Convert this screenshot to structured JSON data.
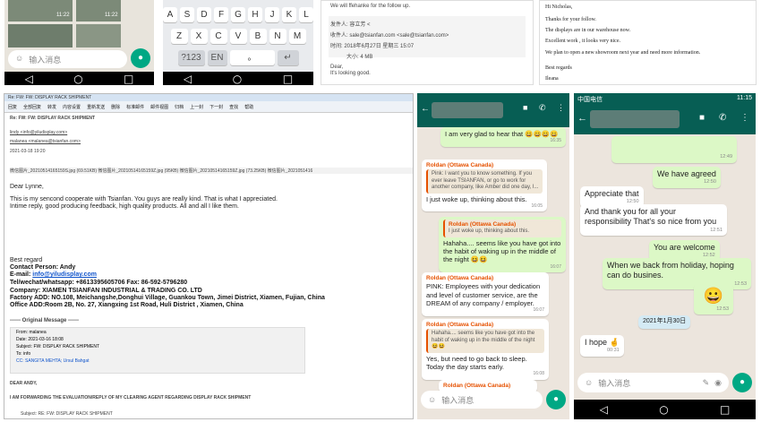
{
  "panel1": {
    "times": [
      "11:22",
      "11:22"
    ],
    "input_placeholder": "输入消息",
    "nav": [
      "◁",
      "○",
      "□"
    ]
  },
  "keyboard": {
    "row1": [
      "A",
      "S",
      "D",
      "F",
      "G",
      "H",
      "J",
      "K",
      "L"
    ],
    "row2": [
      "Z",
      "X",
      "C",
      "V",
      "B",
      "N",
      "M"
    ],
    "row3": [
      "?123",
      "EN",
      "。",
      "↵"
    ],
    "nav": [
      "◁",
      "○",
      "□"
    ]
  },
  "mail_top": {
    "line1": "We will ffehanke for the follow up.",
    "from": "发件人: 容立芳 <",
    "to": "收件人: sale@tsianfan.com <sale@tsianfan.com>",
    "time": "时间: 2018年6月27日 星期三 15:07",
    "size": "大小: 4 MB",
    "dear": "Dear,",
    "good": "It's looking good."
  },
  "letter": {
    "greeting": "Hi Nicholas,",
    "l1": "Thanks for your follow.",
    "l2": "The displays are in our warehouse now.",
    "l3": "Excellent work , it looks very nice.",
    "l4": "We plan to open a new showroom next year and need more information.",
    "l5": "Best regards",
    "l6": "Ileana"
  },
  "outlook": {
    "title": "Re: FW: FW: DISPLAY RACK SHIPMENT",
    "toolbar": [
      "回复",
      "全部回复",
      "转发",
      "内容设置",
      "重新发送",
      "删除",
      "标准邮件",
      "邮件视图",
      "归档",
      "上一封",
      "下一封",
      "查找",
      "帮助"
    ],
    "subject_hd": "Re: FW: FW: DISPLAY RACK SHIPMENT",
    "from": "lindy <info@yiludisplay.com>",
    "to": "malanea <malanea@tsianfan.com>",
    "cc": "2021-03-18 19:20",
    "attachments": "微信图片_20210514165159S.jpg (69.51KB)   微信图片_20210514165159Z.jpg (95KB)   微信图片_20210514165159Z.jpg (73.25KB)   微信图片_2021051416",
    "dear": "Dear Lynne,",
    "body1": "This is my sencond cooperate with Tsianfan. You guys are really kind. That is what I appreciated.",
    "body2": "Intime reply, good producing feedback, high quality products. All and all I like them.",
    "regard": "Best regard",
    "contact": "Contact Person: Andy",
    "email_label": "E-mail: ",
    "email": "info@yiludisplay.com",
    "tel": "Tel/wechat/whatsapp: +8613395605706 Fax: 86-592-5796280",
    "company": "Company: XIAMEN TSIANFAN INDUSTRIAL & TRADING CO. LTD",
    "factory": "Factory ADD: NO.108, Meichangshe,Donghui Village, Guankou Town, Jimei District, Xiamen, Fujian, China",
    "office": "Office ADD:Room 2B, No. 27, Xiangxing 1st Road, Huli District , Xiamen, China",
    "orig_title": "------ Original Message ------",
    "orig_from": "From: malanea",
    "orig_date": "Date: 2021-03-16 18:08",
    "orig_subject": "Subject: FW: DISPLAY RACK SHIPMENT",
    "orig_to": "To: info",
    "orig_cc": "CC: SANGITA MEHTA; Ursul Bahgat",
    "dear2": "DEAR ANDY,",
    "fwd": "I AM FORWARDING THE EVALUATION/REPLY OF MY CLEARING AGENT REGARDING DISPLAY RACK SHIPMENT",
    "subj2": "Subject: RE: FW: DISPLAY RACK SHIPMENT"
  },
  "chat1": {
    "m1": "I am very glad to hear that 😄😄😄😄",
    "m1_time": "16:35",
    "sender": "Roldan (Ottawa Canada)",
    "m2_quote": "Pink: I want you to know something. If you ever leave TSIANFAN, or go to work for another company, like Amber did one day, I...",
    "m2": "I just woke up, thinking about this.",
    "m2_time": "16:05",
    "m3_quote": "I just woke up, thinking about this.",
    "m3": "Hahaha.... seems like you have got into the habit of waking up in the middle of the night 😆😆",
    "m3_time": "16:07",
    "m4": "PINK:  Employees with your dedication and level of customer service, are the DREAM of any company / employer.",
    "m4_time": "16:07",
    "m5_quote": "Hahaha.... seems like you have got into the habit of waking up in the middle of the night 😆😆",
    "m5": "Yes, but need to go back to sleep. Today the day starts early.",
    "m5_time": "16:08",
    "input_placeholder": "输入消息"
  },
  "chat2": {
    "status_left": "中国电信",
    "status_right": "11:15",
    "img_time": "12:49",
    "m1": "We have agreed",
    "m1_time": "12:50",
    "m2": "Appreciate that",
    "m2_time": "12:50",
    "m3": "And thank you for all your responsibility That's so nice from you",
    "m3_time": "12:51",
    "m4": "You are welcome",
    "m4_time": "12:52",
    "m5": "When we back from holiday, hoping can do busines.",
    "m5_time": "12:53",
    "m6": "😀",
    "m6_time": "12:53",
    "date": "2021年1月30日",
    "m7": "I hope 🤞",
    "m7_time": "00:31",
    "input_placeholder": "输入消息",
    "nav": [
      "◁",
      "○",
      "□"
    ]
  }
}
